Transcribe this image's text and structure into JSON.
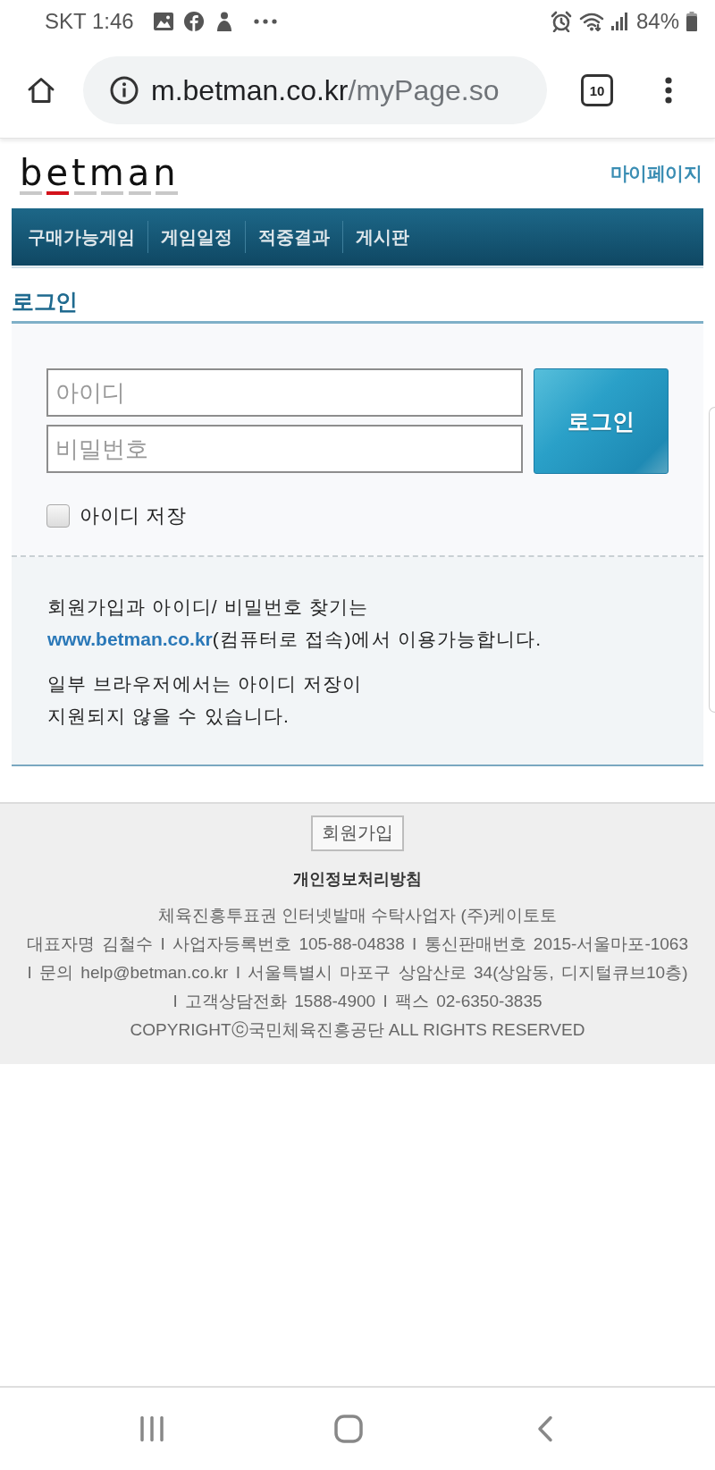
{
  "status_bar": {
    "time": "SKT 1:46",
    "battery": "84%"
  },
  "browser": {
    "url_host": "m.betman.co.kr",
    "url_path": "/myPage.so",
    "tab_count": "10"
  },
  "header": {
    "logo": "betman",
    "my_page": "마이페이지"
  },
  "nav": [
    "구매가능게임",
    "게임일정",
    "적중결과",
    "게시판"
  ],
  "section_title": "로그인",
  "login": {
    "id_placeholder": "아이디",
    "password_placeholder": "비밀번호",
    "button": "로그인",
    "remember": {
      "label": "아이디 저장",
      "checked": false
    }
  },
  "notices": [
    {
      "text": "회원가입과 아이디/ 비밀번호 찾기는",
      "link": "www.betman.co.kr",
      "after": "(컴퓨터로 접속)에서 이용가능합니다."
    },
    {
      "text": "일부 브라우저에서는 아이디 저장이\n지원되지 않을 수 있습니다."
    }
  ],
  "footer": {
    "join": "회원가입",
    "privacy": "개인정보처리방침",
    "company": "체육진흥투표권 인터넷발매 수탁사업자 (주)케이토토",
    "info": "대표자명 김철수 I 사업자등록번호 105-88-04838 I 통신판매번호 2015-서울마포-1063 I 문의 help@betman.co.kr I 서울특별시 마포구 상암산로 34(상암동, 디지털큐브10층) I 고객상담전화 1588-4900 I 팩스 02-6350-3835",
    "copyright": "COPYRIGHTⓒ국민체육진흥공단 ALL RIGHTS RESERVED"
  }
}
